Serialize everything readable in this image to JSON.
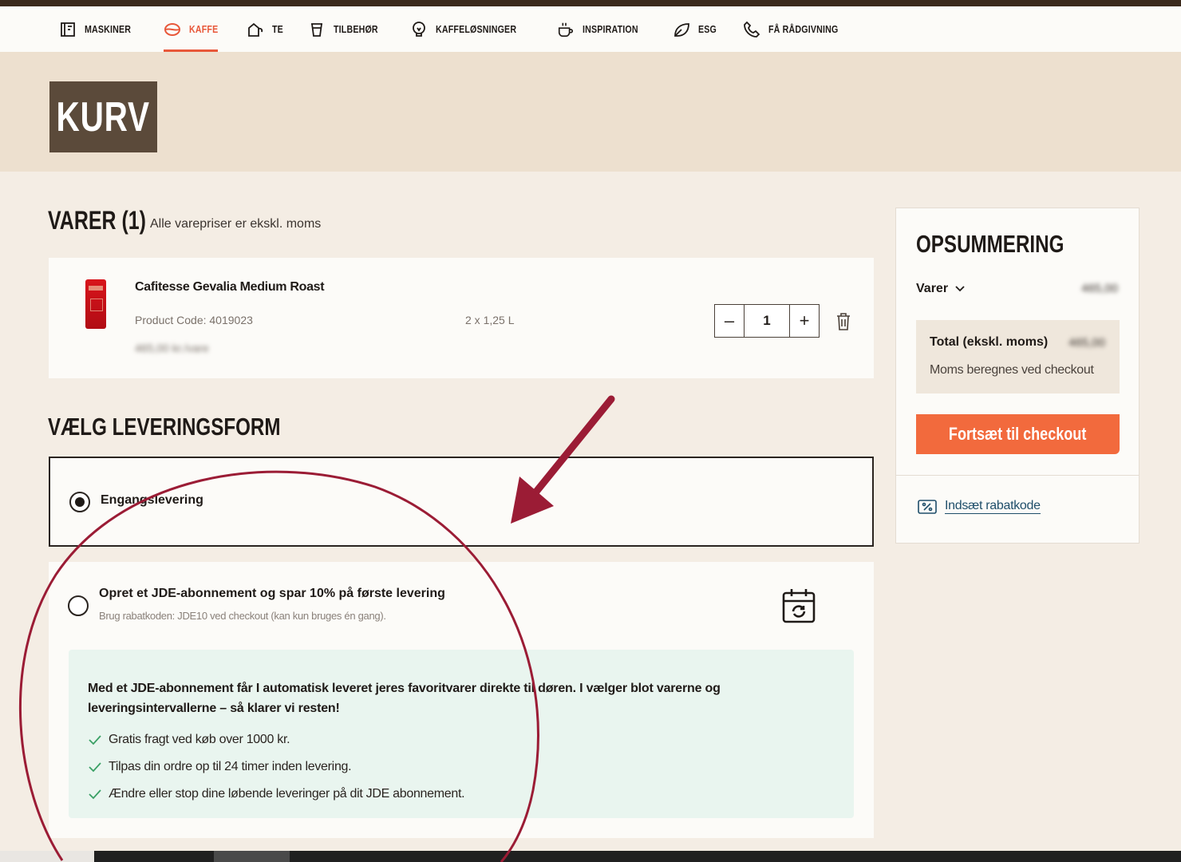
{
  "nav": {
    "items": [
      {
        "label": "MASKINER",
        "icon": "machine-icon",
        "active": false
      },
      {
        "label": "KAFFE",
        "icon": "coffee-bean-icon",
        "active": true
      },
      {
        "label": "TE",
        "icon": "tea-icon",
        "active": false
      },
      {
        "label": "TILBEHØR",
        "icon": "cup-icon",
        "active": false
      },
      {
        "label": "KAFFELØSNINGER",
        "icon": "lightbulb-icon",
        "active": false
      },
      {
        "label": "INSPIRATION",
        "icon": "coffee-cup-icon",
        "active": false
      },
      {
        "label": "ESG",
        "icon": "leaf-icon",
        "active": false
      },
      {
        "label": "FÅ RÅDGIVNING",
        "icon": "phone-icon",
        "active": false
      }
    ],
    "accent": "#e8583a"
  },
  "page": {
    "title": "KURV"
  },
  "cart": {
    "title": "VARER (1)",
    "note": "Alle varepriser er ekskl. moms",
    "item": {
      "name": "Cafitesse Gevalia Medium Roast",
      "code": "Product Code: 4019023",
      "size": "2 x 1,25 L",
      "price": "465,00 kr./vare",
      "quantity": "1",
      "minus": "–",
      "plus": "+"
    }
  },
  "delivery": {
    "title": "VÆLG LEVERINGSFORM",
    "option1": {
      "label": "Engangslevering",
      "selected": true
    },
    "option2": {
      "label": "Opret et JDE-abonnement og spar 10% på første levering",
      "sub": "Brug rabatkoden: JDE10 ved checkout (kan kun bruges én gang).",
      "selected": false,
      "description": "Med et JDE-abonnement får I automatisk leveret jeres favoritvarer direkte til døren. I vælger blot varerne og leveringsintervallerne – så klarer vi resten!",
      "benefits": [
        "Gratis fragt ved køb over 1000 kr.",
        "Tilpas din ordre op til 24 timer inden levering.",
        "Ændre eller stop dine løbende leveringer på dit JDE abonnement."
      ]
    }
  },
  "summary": {
    "title": "OPSUMMERING",
    "varer_label": "Varer",
    "varer_value": "465,00",
    "total_label": "Total (ekskl. moms)",
    "total_value": "465,00",
    "total_note": "Moms beregnes ved checkout",
    "checkout_label": "Fortsæt til checkout",
    "discount_label": "Indsæt rabatkode",
    "checkout_color": "#f26a3d"
  },
  "annotation_color": "#9b1c35"
}
